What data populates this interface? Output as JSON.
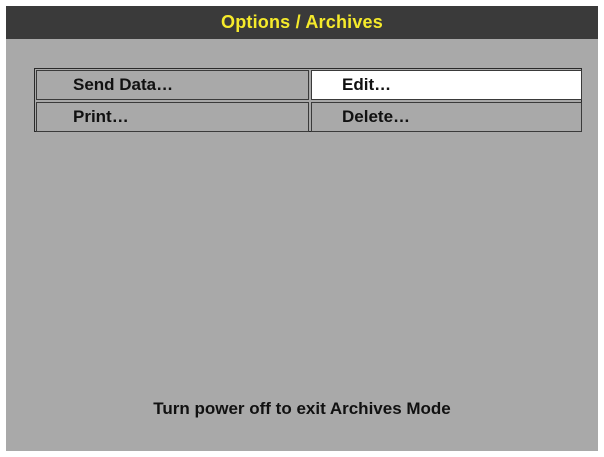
{
  "header": {
    "title": "Options / Archives"
  },
  "menu": {
    "items": [
      {
        "label": "Send Data…",
        "selected": false
      },
      {
        "label": "Edit…",
        "selected": true
      },
      {
        "label": "Print…",
        "selected": false
      },
      {
        "label": "Delete…",
        "selected": false
      }
    ]
  },
  "status": {
    "message": "Turn power off to exit Archives Mode"
  },
  "colors": {
    "title_bar": "#3a3a3a",
    "title_text": "#f5ea2b",
    "background": "#a9a9a9",
    "selected_item": "#ffffff"
  }
}
